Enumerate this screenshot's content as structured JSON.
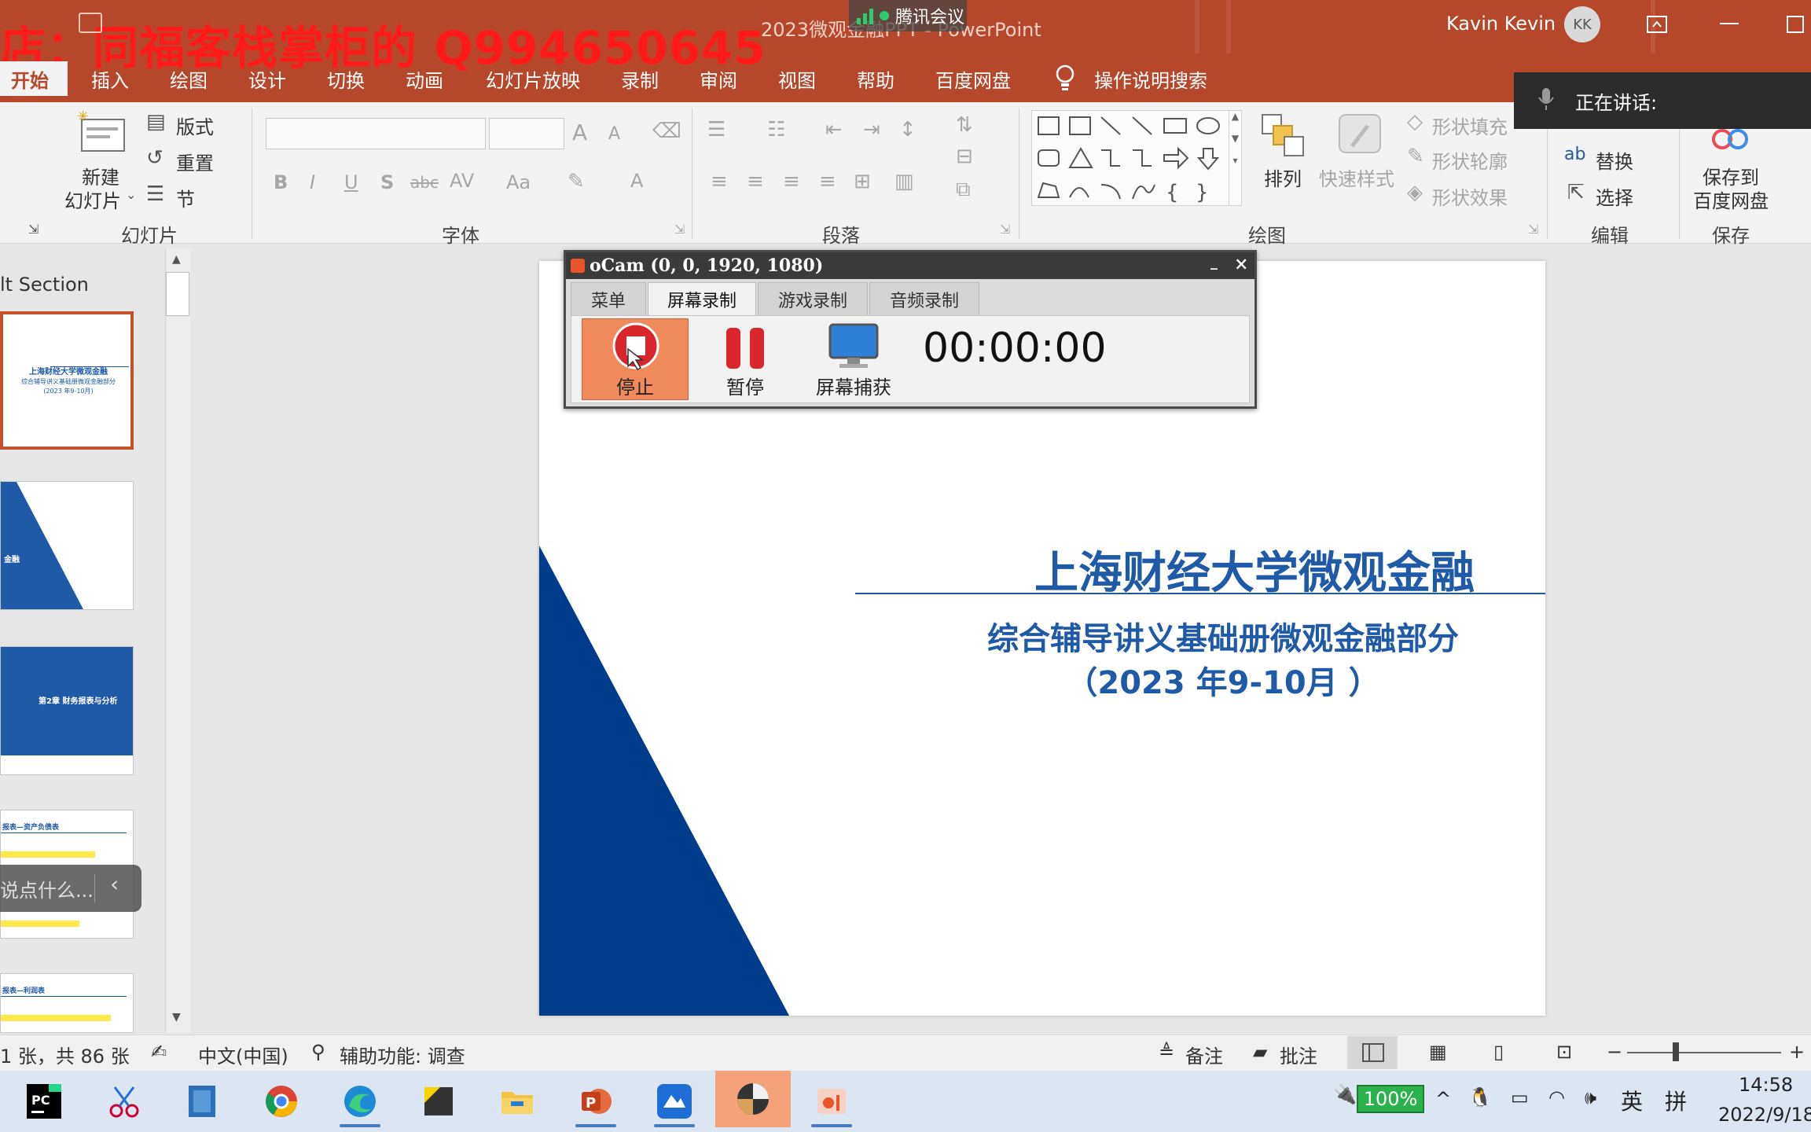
{
  "colors": {
    "accent": "#b7472a",
    "slide_blue": "#1f5aa6",
    "watermark": "#ff1a1a"
  },
  "titlebar": {
    "watermark": "店：同福客栈掌柜的 Q994650645",
    "doc_title": "2023微观金融PPT  -  PowerPoint",
    "meeting_badge": "腾讯会议",
    "user_name": "Kavin Kevin",
    "user_initials": "KK"
  },
  "menu": {
    "items": [
      "开始",
      "插入",
      "绘图",
      "设计",
      "切换",
      "动画",
      "幻灯片放映",
      "录制",
      "审阅",
      "视图",
      "帮助",
      "百度网盘"
    ],
    "active": "开始",
    "tell_me": "操作说明搜索"
  },
  "speaking": {
    "label": "正在讲话:"
  },
  "ribbon": {
    "slides": {
      "new_slide_1": "新建",
      "new_slide_2": "幻灯片",
      "layout": "版式",
      "reset": "重置",
      "section": "节",
      "group": "幻灯片"
    },
    "font": {
      "group": "字体",
      "bold": "B",
      "italic": "I",
      "underline": "U",
      "shadow": "S",
      "strike": "abc",
      "spacing": "AV",
      "case": "Aa",
      "color": "A",
      "grow": "A",
      "shrink": "A"
    },
    "paragraph": {
      "group": "段落"
    },
    "drawing": {
      "arrange": "排列",
      "quick_styles": "快速样式",
      "fill": "形状填充",
      "outline": "形状轮廓",
      "effects": "形状效果",
      "group": "绘图"
    },
    "editing": {
      "replace": "替换",
      "select": "选择",
      "group": "编辑"
    },
    "save": {
      "line1": "保存到",
      "line2": "百度网盘",
      "group": "保存"
    }
  },
  "thumbs": {
    "section": "lt Section",
    "t1_title": "上海财经大学微观金融",
    "t1_sub": "综合辅导讲义基础册微观金融部分",
    "t1_date": "(2023 年9-10月)",
    "t2_a": "金融",
    "t3_a": "第2章 财务报表与分析",
    "t4_a": "报表—资产负债表",
    "t5_a": "报表—利润表",
    "edge_hint": "说点什么..."
  },
  "slide": {
    "title": "上海财经大学微观金融",
    "subtitle1": "综合辅导讲义基础册微观金融部分",
    "subtitle2": "（2023 年9-10月 ）"
  },
  "ocam": {
    "title": "oCam (0, 0, 1920, 1080)",
    "tabs": [
      "菜单",
      "屏幕录制",
      "游戏录制",
      "音频录制"
    ],
    "active_tab": "屏幕录制",
    "stop": "停止",
    "pause": "暂停",
    "capture": "屏幕捕获",
    "time": "00:00:00"
  },
  "statusbar": {
    "slide_count": "1 张，共 86 张",
    "language": "中文(中国)",
    "accessibility": "辅助功能: 调查",
    "notes": "备注",
    "comments": "批注"
  },
  "taskbar": {
    "battery": "100%",
    "ime1": "英",
    "ime2": "拼",
    "time": "14:58",
    "date": "2022/9/18"
  }
}
